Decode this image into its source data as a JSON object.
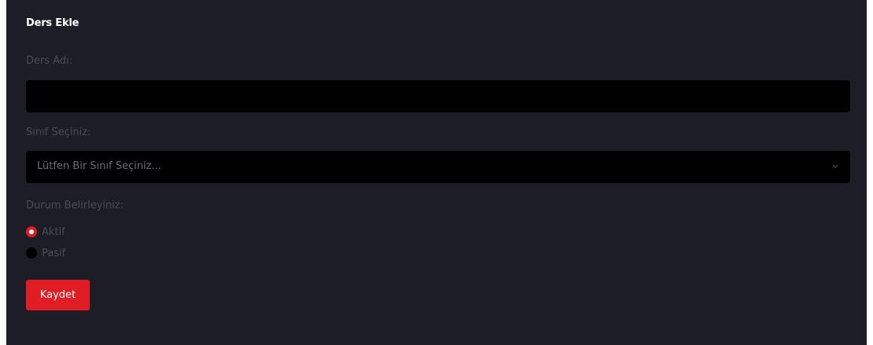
{
  "form": {
    "title": "Ders Ekle",
    "course_name_label": "Ders Adı:",
    "course_name_value": "",
    "class_label": "Sınıf Seçiniz:",
    "class_selected": "Lütfen Bir Sınıf Seçiniz...",
    "status_label": "Durum Belirleyiniz:",
    "status_options": [
      {
        "label": "Aktif",
        "checked": true
      },
      {
        "label": "Pasif",
        "checked": false
      }
    ],
    "save_label": "Kaydet"
  },
  "colors": {
    "card_background": "#1c1d26",
    "input_background": "#000000",
    "accent": "#e11c22",
    "muted_text": "#4a4c59"
  },
  "icons": {
    "select_arrow": "chevron-down-icon"
  }
}
